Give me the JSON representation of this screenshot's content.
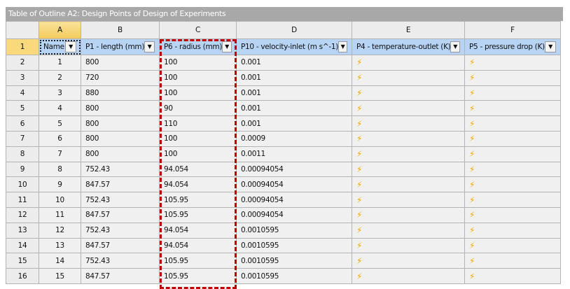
{
  "title": "Table of Outline A2: Design Points of Design of Experiments",
  "column_letters": [
    "A",
    "B",
    "C",
    "D",
    "E",
    "F"
  ],
  "field_row_number": "1",
  "headers": [
    "Name",
    "P1 - length (mm)",
    "P6 - radius (mm)",
    "P10 - velocity-inlet (m s^-1)",
    "P4 - temperature-outlet (K)",
    "P5 - pressure drop (K)"
  ],
  "dropdown_glyph": "▼",
  "bolt_glyph": "⚡",
  "rows": [
    {
      "n": "2",
      "name": "1",
      "p1": "800",
      "p6": "100",
      "p10": "0.001"
    },
    {
      "n": "3",
      "name": "2",
      "p1": "720",
      "p6": "100",
      "p10": "0.001"
    },
    {
      "n": "4",
      "name": "3",
      "p1": "880",
      "p6": "100",
      "p10": "0.001"
    },
    {
      "n": "5",
      "name": "4",
      "p1": "800",
      "p6": "90",
      "p10": "0.001"
    },
    {
      "n": "6",
      "name": "5",
      "p1": "800",
      "p6": "110",
      "p10": "0.001"
    },
    {
      "n": "7",
      "name": "6",
      "p1": "800",
      "p6": "100",
      "p10": "0.0009"
    },
    {
      "n": "8",
      "name": "7",
      "p1": "800",
      "p6": "100",
      "p10": "0.0011"
    },
    {
      "n": "9",
      "name": "8",
      "p1": "752.43",
      "p6": "94.054",
      "p10": "0.00094054"
    },
    {
      "n": "10",
      "name": "9",
      "p1": "847.57",
      "p6": "94.054",
      "p10": "0.00094054"
    },
    {
      "n": "11",
      "name": "10",
      "p1": "752.43",
      "p6": "105.95",
      "p10": "0.00094054"
    },
    {
      "n": "12",
      "name": "11",
      "p1": "847.57",
      "p6": "105.95",
      "p10": "0.00094054"
    },
    {
      "n": "13",
      "name": "12",
      "p1": "752.43",
      "p6": "94.054",
      "p10": "0.0010595"
    },
    {
      "n": "14",
      "name": "13",
      "p1": "847.57",
      "p6": "94.054",
      "p10": "0.0010595"
    },
    {
      "n": "15",
      "name": "14",
      "p1": "752.43",
      "p6": "105.95",
      "p10": "0.0010595"
    },
    {
      "n": "16",
      "name": "15",
      "p1": "847.57",
      "p6": "105.95",
      "p10": "0.0010595"
    }
  ]
}
